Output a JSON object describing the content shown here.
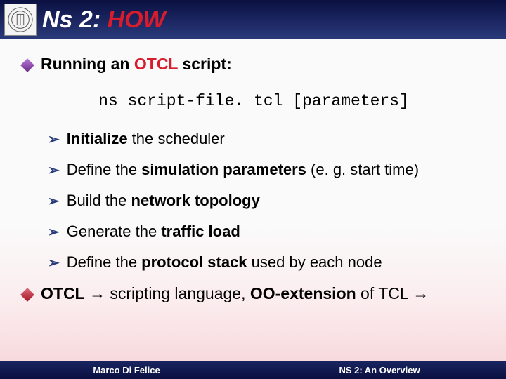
{
  "title": {
    "part1": "Ns 2: ",
    "part2": "HOW"
  },
  "main": {
    "bullet1": {
      "lead": "Running an ",
      "otcl": "OTCL",
      "rest": " script:"
    },
    "command": "ns script-file. tcl [parameters]",
    "steps": [
      {
        "pre": "",
        "bold": "Initialize",
        "post": " the scheduler"
      },
      {
        "pre": "Define the ",
        "bold": "simulation parameters",
        "post": " (e. g. start time)"
      },
      {
        "pre": "Build the ",
        "bold": "network topology",
        "post": ""
      },
      {
        "pre": "Generate the ",
        "bold": "traffic load",
        "post": ""
      },
      {
        "pre": "Define the ",
        "bold": "protocol stack",
        "post": " used by each node"
      }
    ],
    "bullet2": {
      "b1": "OTCL",
      "mid": " → scripting language, ",
      "b2": "OO-extension",
      "post": " of TCL →"
    }
  },
  "footer": {
    "left": "Marco Di Felice",
    "right": "NS 2: An Overview"
  }
}
